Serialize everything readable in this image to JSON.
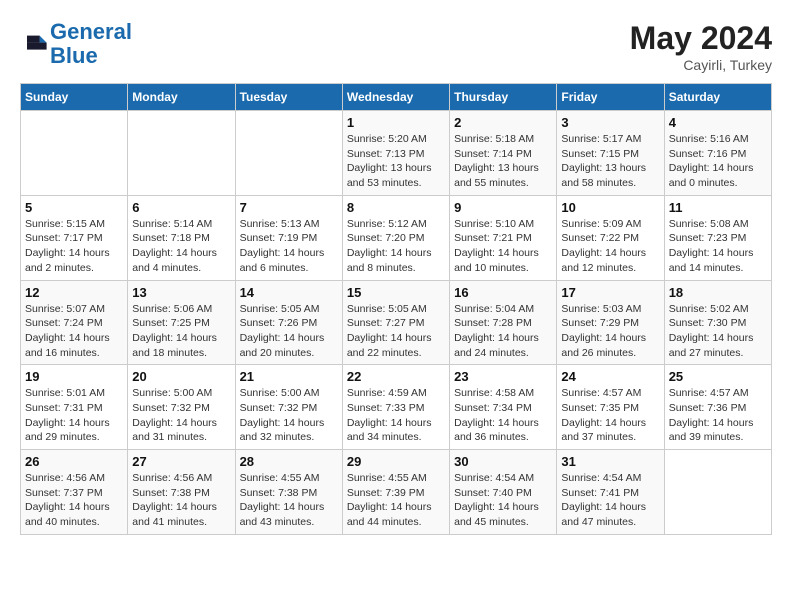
{
  "header": {
    "logo_line1": "General",
    "logo_line2": "Blue",
    "month_year": "May 2024",
    "location": "Cayirli, Turkey"
  },
  "weekdays": [
    "Sunday",
    "Monday",
    "Tuesday",
    "Wednesday",
    "Thursday",
    "Friday",
    "Saturday"
  ],
  "weeks": [
    [
      {
        "day": "",
        "info": ""
      },
      {
        "day": "",
        "info": ""
      },
      {
        "day": "",
        "info": ""
      },
      {
        "day": "1",
        "info": "Sunrise: 5:20 AM\nSunset: 7:13 PM\nDaylight: 13 hours\nand 53 minutes."
      },
      {
        "day": "2",
        "info": "Sunrise: 5:18 AM\nSunset: 7:14 PM\nDaylight: 13 hours\nand 55 minutes."
      },
      {
        "day": "3",
        "info": "Sunrise: 5:17 AM\nSunset: 7:15 PM\nDaylight: 13 hours\nand 58 minutes."
      },
      {
        "day": "4",
        "info": "Sunrise: 5:16 AM\nSunset: 7:16 PM\nDaylight: 14 hours\nand 0 minutes."
      }
    ],
    [
      {
        "day": "5",
        "info": "Sunrise: 5:15 AM\nSunset: 7:17 PM\nDaylight: 14 hours\nand 2 minutes."
      },
      {
        "day": "6",
        "info": "Sunrise: 5:14 AM\nSunset: 7:18 PM\nDaylight: 14 hours\nand 4 minutes."
      },
      {
        "day": "7",
        "info": "Sunrise: 5:13 AM\nSunset: 7:19 PM\nDaylight: 14 hours\nand 6 minutes."
      },
      {
        "day": "8",
        "info": "Sunrise: 5:12 AM\nSunset: 7:20 PM\nDaylight: 14 hours\nand 8 minutes."
      },
      {
        "day": "9",
        "info": "Sunrise: 5:10 AM\nSunset: 7:21 PM\nDaylight: 14 hours\nand 10 minutes."
      },
      {
        "day": "10",
        "info": "Sunrise: 5:09 AM\nSunset: 7:22 PM\nDaylight: 14 hours\nand 12 minutes."
      },
      {
        "day": "11",
        "info": "Sunrise: 5:08 AM\nSunset: 7:23 PM\nDaylight: 14 hours\nand 14 minutes."
      }
    ],
    [
      {
        "day": "12",
        "info": "Sunrise: 5:07 AM\nSunset: 7:24 PM\nDaylight: 14 hours\nand 16 minutes."
      },
      {
        "day": "13",
        "info": "Sunrise: 5:06 AM\nSunset: 7:25 PM\nDaylight: 14 hours\nand 18 minutes."
      },
      {
        "day": "14",
        "info": "Sunrise: 5:05 AM\nSunset: 7:26 PM\nDaylight: 14 hours\nand 20 minutes."
      },
      {
        "day": "15",
        "info": "Sunrise: 5:05 AM\nSunset: 7:27 PM\nDaylight: 14 hours\nand 22 minutes."
      },
      {
        "day": "16",
        "info": "Sunrise: 5:04 AM\nSunset: 7:28 PM\nDaylight: 14 hours\nand 24 minutes."
      },
      {
        "day": "17",
        "info": "Sunrise: 5:03 AM\nSunset: 7:29 PM\nDaylight: 14 hours\nand 26 minutes."
      },
      {
        "day": "18",
        "info": "Sunrise: 5:02 AM\nSunset: 7:30 PM\nDaylight: 14 hours\nand 27 minutes."
      }
    ],
    [
      {
        "day": "19",
        "info": "Sunrise: 5:01 AM\nSunset: 7:31 PM\nDaylight: 14 hours\nand 29 minutes."
      },
      {
        "day": "20",
        "info": "Sunrise: 5:00 AM\nSunset: 7:32 PM\nDaylight: 14 hours\nand 31 minutes."
      },
      {
        "day": "21",
        "info": "Sunrise: 5:00 AM\nSunset: 7:32 PM\nDaylight: 14 hours\nand 32 minutes."
      },
      {
        "day": "22",
        "info": "Sunrise: 4:59 AM\nSunset: 7:33 PM\nDaylight: 14 hours\nand 34 minutes."
      },
      {
        "day": "23",
        "info": "Sunrise: 4:58 AM\nSunset: 7:34 PM\nDaylight: 14 hours\nand 36 minutes."
      },
      {
        "day": "24",
        "info": "Sunrise: 4:57 AM\nSunset: 7:35 PM\nDaylight: 14 hours\nand 37 minutes."
      },
      {
        "day": "25",
        "info": "Sunrise: 4:57 AM\nSunset: 7:36 PM\nDaylight: 14 hours\nand 39 minutes."
      }
    ],
    [
      {
        "day": "26",
        "info": "Sunrise: 4:56 AM\nSunset: 7:37 PM\nDaylight: 14 hours\nand 40 minutes."
      },
      {
        "day": "27",
        "info": "Sunrise: 4:56 AM\nSunset: 7:38 PM\nDaylight: 14 hours\nand 41 minutes."
      },
      {
        "day": "28",
        "info": "Sunrise: 4:55 AM\nSunset: 7:38 PM\nDaylight: 14 hours\nand 43 minutes."
      },
      {
        "day": "29",
        "info": "Sunrise: 4:55 AM\nSunset: 7:39 PM\nDaylight: 14 hours\nand 44 minutes."
      },
      {
        "day": "30",
        "info": "Sunrise: 4:54 AM\nSunset: 7:40 PM\nDaylight: 14 hours\nand 45 minutes."
      },
      {
        "day": "31",
        "info": "Sunrise: 4:54 AM\nSunset: 7:41 PM\nDaylight: 14 hours\nand 47 minutes."
      },
      {
        "day": "",
        "info": ""
      }
    ]
  ]
}
